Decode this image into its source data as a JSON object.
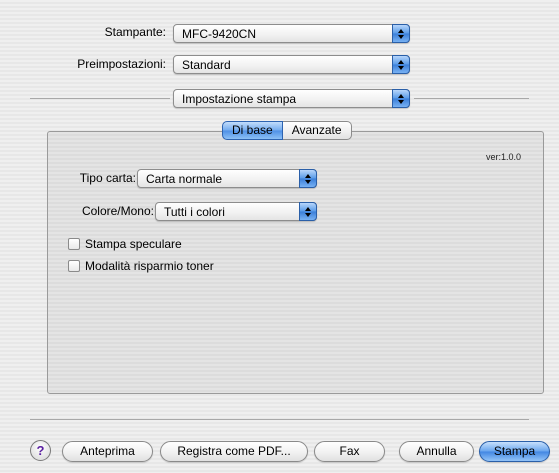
{
  "header": {
    "printer_label": "Stampante:",
    "printer_value": "MFC-9420CN",
    "presets_label": "Preimpostazioni:",
    "presets_value": "Standard",
    "section_value": "Impostazione stampa"
  },
  "tabs": [
    {
      "label": "Di base",
      "selected": true
    },
    {
      "label": "Avanzate",
      "selected": false
    }
  ],
  "panel": {
    "version": "ver:1.0.0",
    "paper_type_label": "Tipo carta:",
    "paper_type_value": "Carta normale",
    "color_label": "Colore/Mono:",
    "color_value": "Tutti i colori",
    "mirror_print_label": "Stampa speculare",
    "mirror_print_checked": false,
    "toner_save_label": "Modalità risparmio toner",
    "toner_save_checked": false
  },
  "footer": {
    "help_glyph": "?",
    "preview_label": "Anteprima",
    "save_pdf_label": "Registra come PDF...",
    "fax_label": "Fax",
    "cancel_label": "Annulla",
    "print_label": "Stampa"
  },
  "colors": {
    "accent_blue": "#4f90e6",
    "help_glyph": "#5a1fa0"
  }
}
